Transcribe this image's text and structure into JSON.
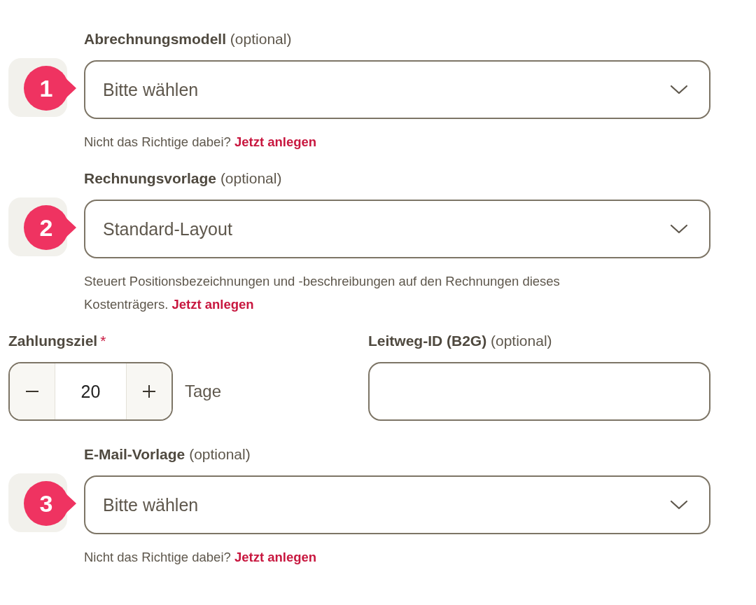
{
  "sections": [
    {
      "kind": "select",
      "marker": "1",
      "label": "**Abrechnungsmodell** (optional)",
      "value": "Bitte wählen",
      "help": "Nicht das Richtige dabei?",
      "link": "Jetzt anlegen"
    },
    {
      "kind": "select",
      "marker": "2",
      "label": "**Rechnungsvorlage** (optional)",
      "value": "Standard-Layout",
      "help": "Steuert Positionsbezeichnungen und -beschreibungen auf den Rechnungen dieses Kostenträgers.",
      "link": "Jetzt anlegen"
    },
    {
      "kind": "row",
      "fields": [
        {
          "kind": "stepper",
          "label": "Zahlungsziel",
          "required_mark": "*",
          "value": "20",
          "unit": "Tage"
        },
        {
          "kind": "text",
          "label": "**Leitweg-ID (B2G)** (optional)"
        }
      ]
    },
    {
      "kind": "select",
      "marker": "3",
      "label": "**E-Mail-Vorlage** (optional)",
      "value": "Bitte wählen",
      "help": "Nicht das Richtige dabei?",
      "link": "Jetzt anlegen"
    }
  ]
}
